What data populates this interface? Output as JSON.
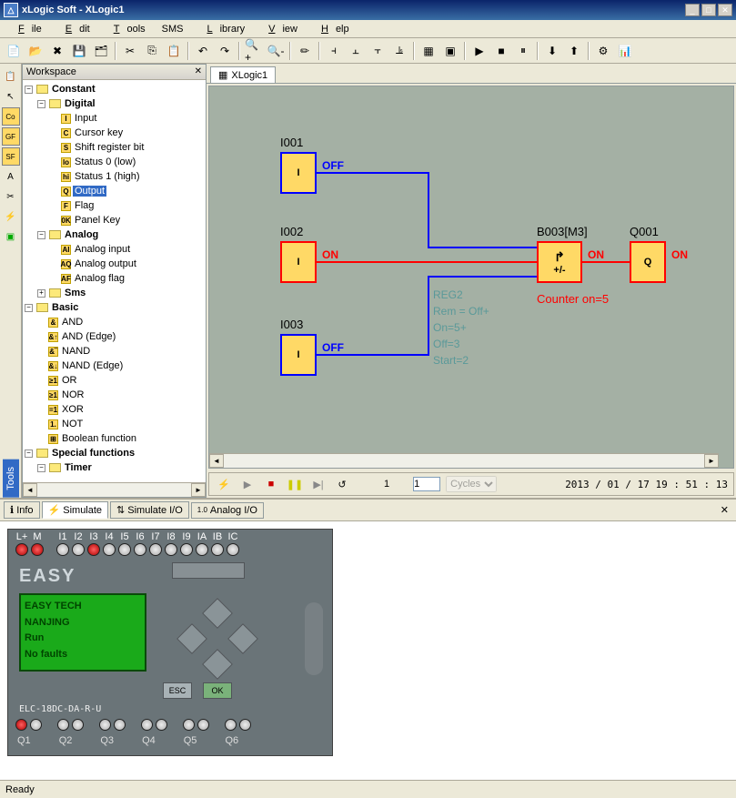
{
  "window": {
    "title": "xLogic Soft - XLogic1"
  },
  "menu": {
    "file": "File",
    "edit": "Edit",
    "tools": "Tools",
    "sms": "SMS",
    "library": "Library",
    "view": "View",
    "help": "Help"
  },
  "workspace": {
    "title": "Workspace",
    "tree": {
      "constant": "Constant",
      "digital": "Digital",
      "digital_items": [
        {
          "ico": "I",
          "label": "Input"
        },
        {
          "ico": "C",
          "label": "Cursor key"
        },
        {
          "ico": "S",
          "label": "Shift register bit"
        },
        {
          "ico": "lo",
          "label": "Status 0 (low)"
        },
        {
          "ico": "hi",
          "label": "Status 1 (high)"
        },
        {
          "ico": "Q",
          "label": "Output",
          "selected": true
        },
        {
          "ico": "F",
          "label": "Flag"
        },
        {
          "ico": "0K",
          "label": "Panel Key"
        }
      ],
      "analog": "Analog",
      "analog_items": [
        {
          "ico": "AI",
          "label": "Analog input"
        },
        {
          "ico": "AQ",
          "label": "Analog output"
        },
        {
          "ico": "AF",
          "label": "Analog flag"
        }
      ],
      "sms": "Sms",
      "basic": "Basic",
      "basic_items": [
        {
          "ico": "&",
          "label": "AND"
        },
        {
          "ico": "&↑",
          "label": "AND (Edge)"
        },
        {
          "ico": "&‾",
          "label": "NAND"
        },
        {
          "ico": "&↓",
          "label": "NAND (Edge)"
        },
        {
          "ico": "≥1",
          "label": "OR"
        },
        {
          "ico": "≥1",
          "label": "NOR"
        },
        {
          "ico": "=1",
          "label": "XOR"
        },
        {
          "ico": "1.",
          "label": "NOT"
        },
        {
          "ico": "⊞",
          "label": "Boolean function"
        }
      ],
      "special": "Special functions",
      "timer": "Timer"
    }
  },
  "doc_tab": "XLogic1",
  "canvas": {
    "blocks": {
      "i001": {
        "label": "I001",
        "sym": "I",
        "state": "OFF"
      },
      "i002": {
        "label": "I002",
        "sym": "I",
        "state": "ON"
      },
      "i003": {
        "label": "I003",
        "sym": "I",
        "state": "OFF"
      },
      "b003": {
        "label": "B003[M3]",
        "sym_top": "↱",
        "sym_bot": "+/-"
      },
      "q001": {
        "label": "Q001",
        "sym": "Q",
        "state": "ON"
      }
    },
    "params": {
      "l1": "REG2",
      "l2": "Rem = Off+",
      "l3": "On=5+",
      "l4": "Off=3",
      "l5": "Start=2"
    },
    "counter_label": "Counter on=5"
  },
  "sim_bar": {
    "page": "1",
    "cycles_label": "Cycles",
    "timestamp": "2013 / 01 / 17 19 : 51 : 13",
    "cycles_value": "1"
  },
  "bottom_tabs": {
    "info": "Info",
    "simulate": "Simulate",
    "simulate_io": "Simulate I/O",
    "analog_io": "Analog I/O"
  },
  "plc": {
    "top_labels": [
      "L+",
      "M",
      "",
      "I1",
      "I2",
      "I3",
      "I4",
      "I5",
      "I6",
      "I7",
      "I8",
      "I9",
      "IA",
      "IB",
      "IC"
    ],
    "logo": "EASY",
    "lcd": {
      "l1": "EASY TECH",
      "l2": "NANJING",
      "l3": " Run",
      "l4": "No  faults"
    },
    "esc": "ESC",
    "ok": "OK",
    "model": "ELC-18DC-DA-R-U",
    "out_labels": [
      "Q1",
      "Q2",
      "Q3",
      "Q4",
      "Q5",
      "Q6"
    ]
  },
  "status": "Ready"
}
